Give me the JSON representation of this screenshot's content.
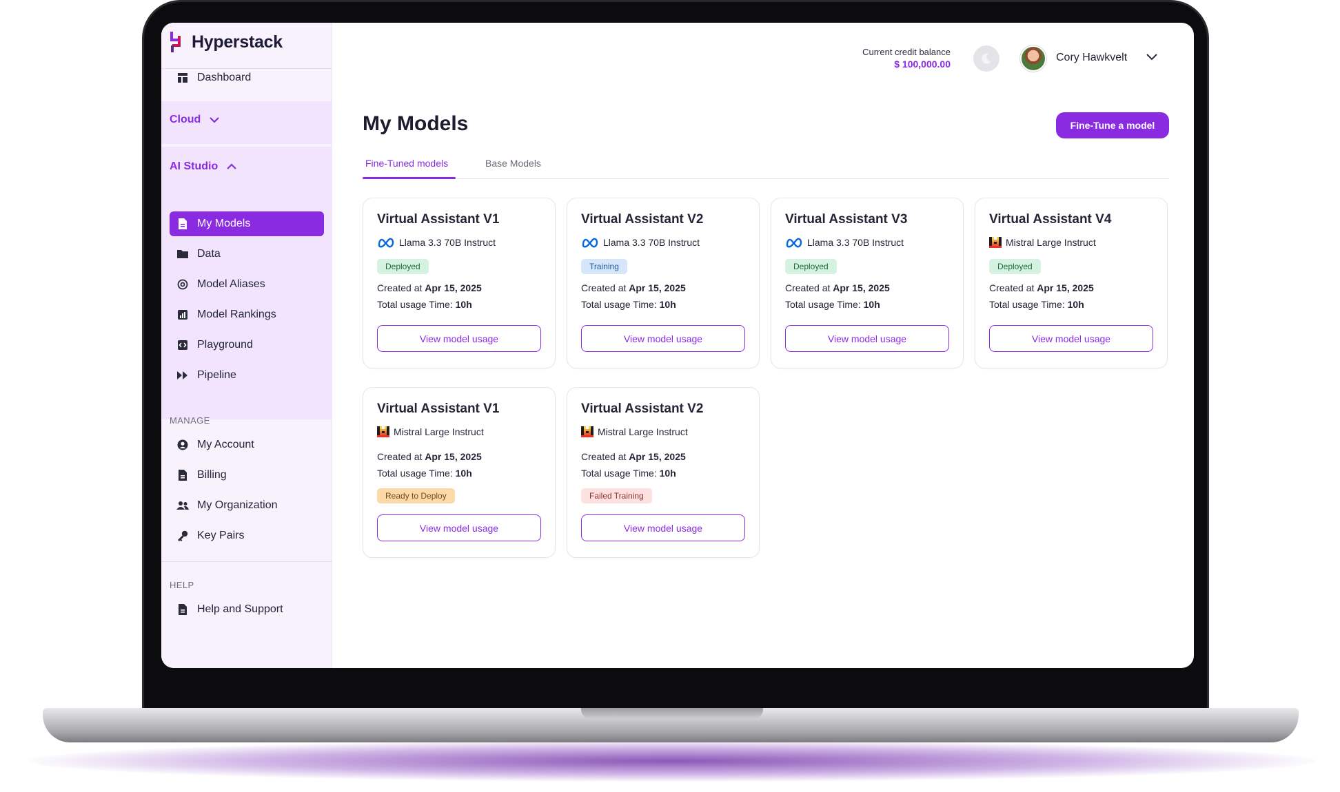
{
  "brand": {
    "name": "Hyperstack"
  },
  "sidebar": {
    "dashboard": "Dashboard",
    "cloud": "Cloud",
    "ai_studio": "AI Studio",
    "ai_items": [
      "My Models",
      "Data",
      "Model Aliases",
      "Model Rankings",
      "Playground",
      "Pipeline"
    ],
    "manage_label": "MANAGE",
    "manage_items": [
      "My Account",
      "Billing",
      "My Organization",
      "Key Pairs"
    ],
    "help_label": "HELP",
    "help_items": [
      "Help and Support"
    ]
  },
  "header": {
    "credit_label": "Current credit balance",
    "credit_value": "$ 100,000.00",
    "user_name": "Cory Hawkvelt"
  },
  "main": {
    "title": "My Models",
    "primary_button": "Fine-Tune a model",
    "tabs": [
      "Fine-Tuned models",
      "Base Models"
    ],
    "created_prefix": "Created at",
    "usage_prefix": "Total usage Time:",
    "cards": [
      {
        "title": "Virtual Assistant V1",
        "base": "Llama 3.3 70B Instruct",
        "base_icon": "meta-icon",
        "status": "Deployed",
        "created": "Apr 15, 2025",
        "usage": "10h",
        "button": "View model usage"
      },
      {
        "title": "Virtual Assistant V2",
        "base": "Llama 3.3 70B Instruct",
        "base_icon": "meta-icon",
        "status": "Training",
        "created": "Apr 15, 2025",
        "usage": "10h",
        "button": "View model usage"
      },
      {
        "title": "Virtual Assistant V3",
        "base": "Llama 3.3 70B Instruct",
        "base_icon": "meta-icon",
        "status": "Deployed",
        "created": "Apr 15, 2025",
        "usage": "10h",
        "button": "View model usage"
      },
      {
        "title": "Virtual Assistant V4",
        "base": "Mistral Large Instruct",
        "base_icon": "mistral-icon",
        "status": "Deployed",
        "created": "Apr 15, 2025",
        "usage": "10h",
        "button": "View model usage"
      },
      {
        "title": "Virtual Assistant V1",
        "base": "Mistral Large Instruct",
        "base_icon": "mistral-icon",
        "status": "Ready to Deploy",
        "created": "Apr 15, 2025",
        "usage": "10h",
        "button": "View model usage"
      },
      {
        "title": "Virtual Assistant V2",
        "base": "Mistral Large Instruct",
        "base_icon": "mistral-icon",
        "status": "Failed Training",
        "created": "Apr 15, 2025",
        "usage": "10h",
        "button": "View model usage"
      }
    ]
  },
  "colors": {
    "accent": "#8a2be2",
    "sidebar_bg": "#f8f2fd",
    "section_bg": "#f1e4fc"
  }
}
